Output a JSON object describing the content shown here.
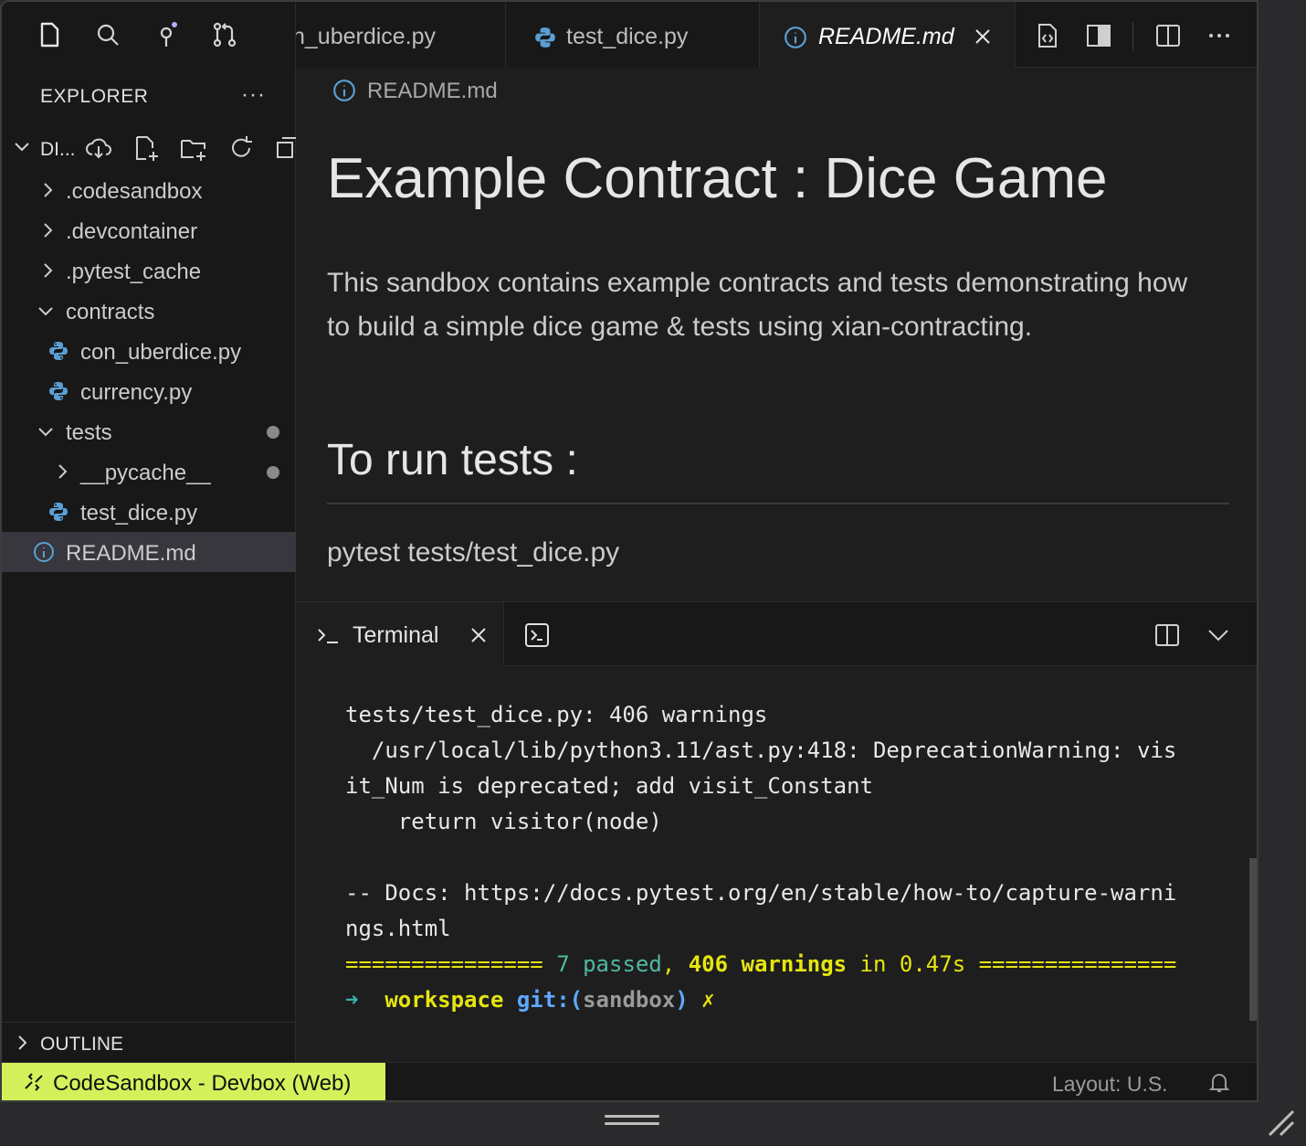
{
  "window": {
    "activity_icons": [
      "files-icon",
      "search-icon",
      "source-control-icon",
      "pull-request-icon"
    ]
  },
  "sidebar": {
    "header": "EXPLORER",
    "more": "···",
    "root_label": "DI...",
    "tree": [
      {
        "label": ".codesandbox",
        "kind": "folder",
        "expanded": false
      },
      {
        "label": ".devcontainer",
        "kind": "folder",
        "expanded": false
      },
      {
        "label": ".pytest_cache",
        "kind": "folder",
        "expanded": false
      },
      {
        "label": "contracts",
        "kind": "folder",
        "expanded": true
      },
      {
        "label": "con_uberdice.py",
        "kind": "python"
      },
      {
        "label": "currency.py",
        "kind": "python"
      },
      {
        "label": "tests",
        "kind": "folder",
        "expanded": true,
        "modified": true
      },
      {
        "label": "__pycache__",
        "kind": "folder",
        "expanded": false,
        "modified": true
      },
      {
        "label": "test_dice.py",
        "kind": "python"
      },
      {
        "label": "README.md",
        "kind": "info",
        "selected": true
      }
    ],
    "outline": "OUTLINE"
  },
  "tabs": [
    {
      "label": "n_uberdice.py"
    },
    {
      "label": "test_dice.py"
    },
    {
      "label": "README.md",
      "active": true
    }
  ],
  "editor": {
    "breadcrumb": "README.md",
    "h1": "Example Contract : Dice Game",
    "paragraph": "This sandbox contains example contracts and tests demonstrating how to build a simple dice game & tests using xian-contracting.",
    "h2": "To run tests :",
    "code": "pytest tests/test_dice.py"
  },
  "panel": {
    "tab_label": "Terminal",
    "terminal": {
      "line1": "tests/test_dice.py: 406 warnings",
      "line2": "  /usr/local/lib/python3.11/ast.py:418: DeprecationWarning: vis",
      "line3": "it_Num is deprecated; add visit_Constant",
      "line4": "    return visitor(node)",
      "line5": "-- Docs: https://docs.pytest.org/en/stable/how-to/capture-warni",
      "line6": "ngs.html",
      "summary_rule": "===============",
      "summary_passed": "7 passed",
      "summary_comma": ",",
      "summary_warnings": "406 warnings",
      "summary_in": "in",
      "summary_time": "0.47s",
      "prompt_arrow": "➜",
      "prompt_dir": "workspace",
      "prompt_git": "git:(",
      "prompt_branch": "sandbox",
      "prompt_git_close": ")",
      "prompt_dirty": "✗"
    }
  },
  "statusbar": {
    "remote": "CodeSandbox - Devbox (Web)",
    "layout": "Layout: U.S.",
    "accent": "#d4f15c"
  }
}
